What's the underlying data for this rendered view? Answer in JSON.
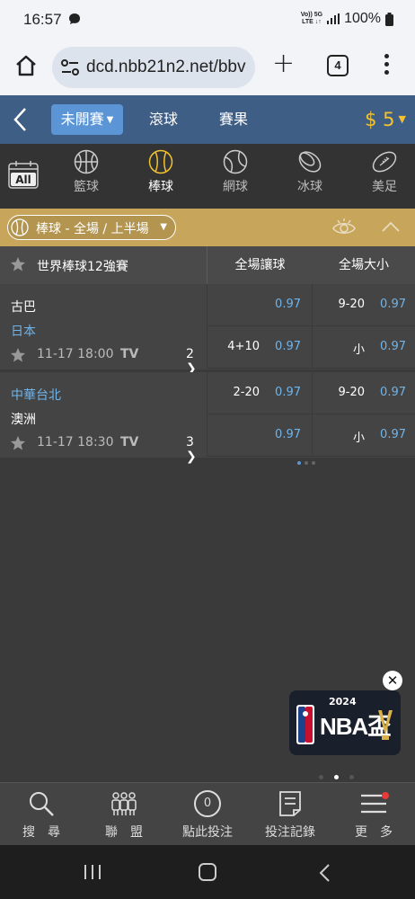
{
  "status_bar": {
    "time": "16:57",
    "network_top": "Vo)) 5G",
    "network_bottom": "LTE ↓↑",
    "battery": "100%"
  },
  "browser": {
    "url": "dcd.nbb21n2.net/bbv",
    "tab_count": "4"
  },
  "header": {
    "tab_upcoming": "未開賽",
    "tab_live": "滾球",
    "tab_results": "賽果",
    "balance": "$ 5"
  },
  "sports": [
    {
      "label": "All",
      "icon": "calendar-icon"
    },
    {
      "label": "籃球",
      "icon": "basketball-icon"
    },
    {
      "label": "棒球",
      "icon": "baseball-icon"
    },
    {
      "label": "網球",
      "icon": "tennis-icon"
    },
    {
      "label": "冰球",
      "icon": "hockey-puck-icon"
    },
    {
      "label": "美足",
      "icon": "football-icon"
    }
  ],
  "filter": {
    "label": "棒球 - 全場 / 上半場"
  },
  "league": {
    "name": "世界棒球12強賽",
    "col_handicap": "全場讓球",
    "col_ou": "全場大小"
  },
  "matches": [
    {
      "home": "古巴",
      "away": "日本",
      "time": "11-17 18:00",
      "tv": "TV",
      "more": "2",
      "handicap": [
        {
          "line": "",
          "price": "0.97"
        },
        {
          "line": "4+10",
          "price": "0.97"
        }
      ],
      "ou": [
        {
          "line": "9-20",
          "price": "0.97"
        },
        {
          "line": "小",
          "price": "0.97"
        }
      ]
    },
    {
      "home": "中華台北",
      "away": "澳洲",
      "time": "11-17 18:30",
      "tv": "TV",
      "more": "3",
      "handicap": [
        {
          "line": "2-20",
          "price": "0.97"
        },
        {
          "line": "",
          "price": "0.97"
        }
      ],
      "ou": [
        {
          "line": "9-20",
          "price": "0.97"
        },
        {
          "line": "小",
          "price": "0.97"
        }
      ]
    }
  ],
  "promo": {
    "year": "2024",
    "title": "NBA盃"
  },
  "bottom_nav": {
    "search": "搜　尋",
    "league": "聯　盟",
    "bet": "點此投注",
    "bet_count": "0",
    "records": "投注記錄",
    "more": "更　多"
  },
  "colors": {
    "header": "#3e5e86",
    "accent": "#5b95d6",
    "gold": "#c7a65c",
    "balance": "#f2c230",
    "odds": "#6fb4ea"
  }
}
